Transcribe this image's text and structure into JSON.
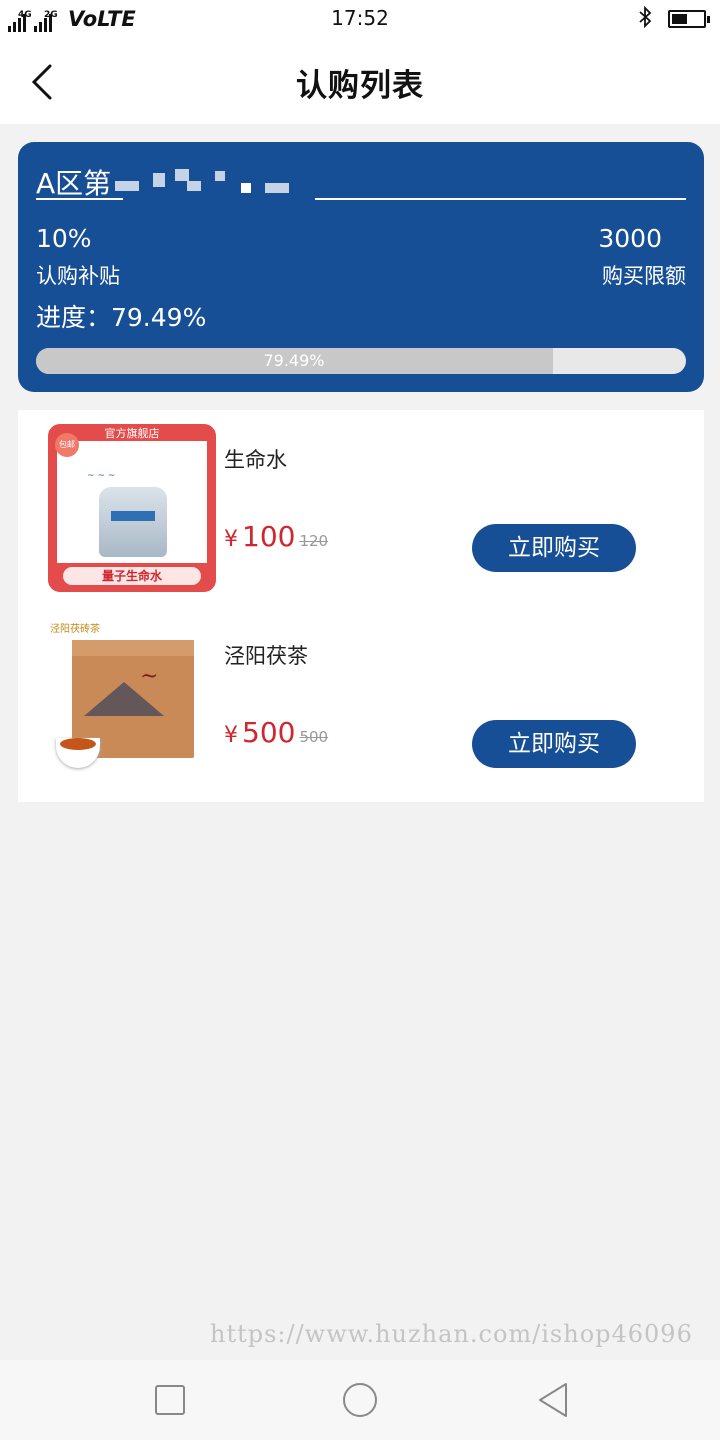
{
  "status_bar": {
    "network_1": "4G",
    "network_2": "2G",
    "volte": "VoLTE",
    "time": "17:52",
    "battery_level": 0.45,
    "icons": [
      "signal-icon",
      "bluetooth-icon",
      "battery-icon"
    ]
  },
  "header": {
    "title": "认购列表",
    "back_icon": "chevron-left-icon"
  },
  "summary": {
    "zone_name": "A区第",
    "subsidy_value": "10%",
    "subsidy_label": "认购补贴",
    "limit_value": "3000",
    "limit_label": "购买限额",
    "progress_text": "进度：79.49%",
    "progress_percent": 79.49,
    "progress_bar_label": "79.49%",
    "colors": {
      "card_bg": "#174f96",
      "track": "#e8e8e8",
      "fill": "#c8c8c8"
    }
  },
  "products": [
    {
      "name": "生命水",
      "currency": "¥",
      "price": "100",
      "original_price": "120",
      "button_label": "立即购买",
      "image": {
        "store_label": "官方旗舰店",
        "tag": "包邮",
        "banner": "量子生命水"
      }
    },
    {
      "name": "泾阳茯茶",
      "currency": "¥",
      "price": "500",
      "original_price": "500",
      "button_label": "立即购买",
      "image": {
        "brand": "泾阳茯砖茶"
      }
    }
  ],
  "colors": {
    "accent": "#174f96",
    "price": "#d0262e",
    "page_bg": "#f2f2f2"
  },
  "watermark": "https://www.huzhan.com/ishop46096",
  "system_nav": {
    "icons": [
      "recent-apps-icon",
      "home-icon",
      "back-icon"
    ]
  }
}
